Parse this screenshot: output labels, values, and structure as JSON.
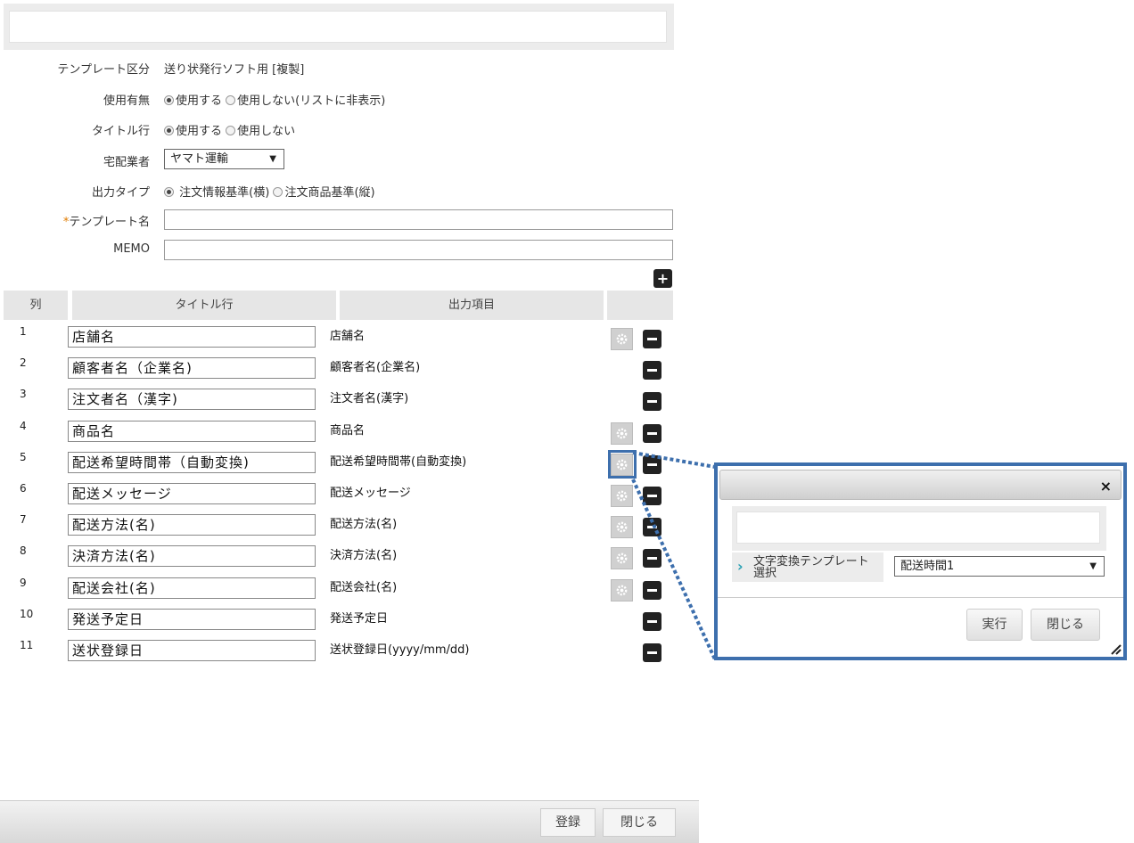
{
  "form": {
    "template_type_label": "テンプレート区分",
    "template_type_value": "送り状発行ソフト用 [複製]",
    "usage_label": "使用有無",
    "usage_option1": "使用する",
    "usage_option2": "使用しない(リストに非表示)",
    "title_row_label": "タイトル行",
    "title_row_option1": "使用する",
    "title_row_option2": "使用しない",
    "carrier_label": "宅配業者",
    "carrier_value": "ヤマト運輸",
    "output_type_label": "出力タイプ",
    "output_type_option1": "注文情報基準(横)",
    "output_type_option2": "注文商品基準(縦)",
    "required_mark": "*",
    "template_name_label": "テンプレート名",
    "template_name_value": "",
    "memo_label": "MEMO",
    "memo_value": ""
  },
  "table": {
    "headers": {
      "col": "列",
      "title": "タイトル行",
      "output": "出力項目"
    },
    "rows": [
      {
        "num": "1",
        "title": "店舗名",
        "output": "店舗名",
        "gear": true
      },
      {
        "num": "2",
        "title": "顧客者名（企業名)",
        "output": "顧客者名(企業名)",
        "gear": false
      },
      {
        "num": "3",
        "title": "注文者名（漢字)",
        "output": "注文者名(漢字)",
        "gear": false
      },
      {
        "num": "4",
        "title": "商品名",
        "output": "商品名",
        "gear": true
      },
      {
        "num": "5",
        "title": "配送希望時間帯（自動変換)",
        "output": "配送希望時間帯(自動変換)",
        "gear": true
      },
      {
        "num": "6",
        "title": "配送メッセージ",
        "output": "配送メッセージ",
        "gear": true
      },
      {
        "num": "7",
        "title": "配送方法(名)",
        "output": "配送方法(名)",
        "gear": true
      },
      {
        "num": "8",
        "title": "決済方法(名)",
        "output": "決済方法(名)",
        "gear": true
      },
      {
        "num": "9",
        "title": "配送会社(名)",
        "output": "配送会社(名)",
        "gear": true
      },
      {
        "num": "10",
        "title": "発送予定日",
        "output": "発送予定日",
        "gear": false
      },
      {
        "num": "11",
        "title": "送状登録日",
        "output": "送状登録日(yyyy/mm/dd)",
        "gear": false
      }
    ]
  },
  "footer": {
    "register": "登録",
    "close": "閉じる"
  },
  "dialog": {
    "close_glyph": "×",
    "chevron": "›",
    "label_line1": "文字変換テンプレート",
    "label_line2": "選択",
    "select_value": "配送時間1",
    "run_button": "実行",
    "close_button": "閉じる"
  },
  "colors": {
    "highlight": "#3d6fad",
    "button_dark": "#222222",
    "header_bg": "#e6e6e6"
  }
}
